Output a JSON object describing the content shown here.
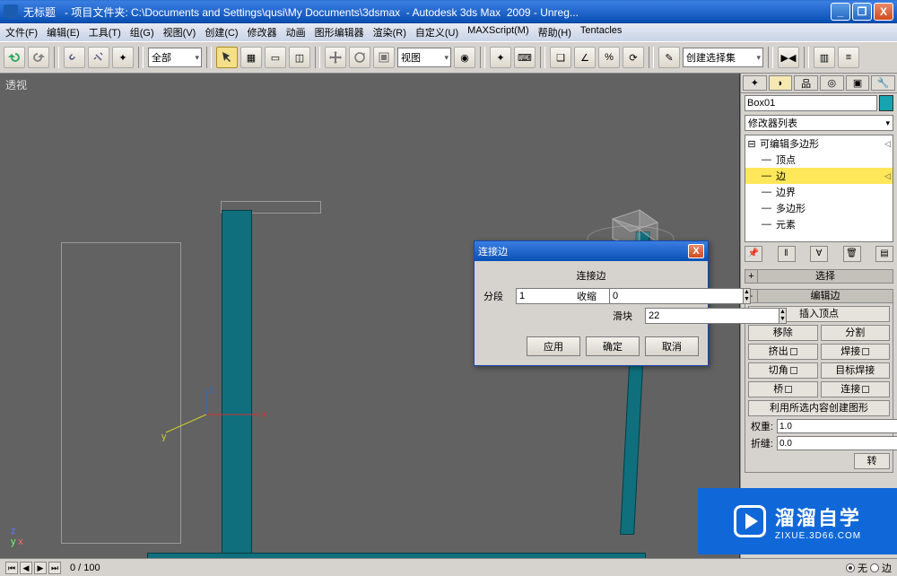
{
  "title": "无标题   - 项目文件夹: C:\\Documents and Settings\\qusi\\My Documents\\3dsmax  - Autodesk 3ds Max  2009 - Unreg...",
  "menu": [
    "文件(F)",
    "编辑(E)",
    "工具(T)",
    "组(G)",
    "视图(V)",
    "创建(C)",
    "修改器",
    "动画",
    "图形编辑器",
    "渲染(R)",
    "自定义(U)",
    "MAXScript(M)",
    "帮助(H)",
    "Tentacles"
  ],
  "toolbar": {
    "sel_filter": "全部",
    "view_dd": "视图",
    "named_sel": "创建选择集"
  },
  "viewport": {
    "label": "透视"
  },
  "panel": {
    "obj_name": "Box01",
    "mod_list": "修改器列表",
    "stack_root": "可编辑多边形",
    "sub": {
      "vertex": "顶点",
      "edge": "边",
      "border": "边界",
      "poly": "多边形",
      "element": "元素"
    },
    "rollout_sel": "选择",
    "rollout_edit": "编辑边",
    "btns": {
      "insert": "插入顶点",
      "remove": "移除",
      "split": "分割",
      "extrude": "挤出",
      "weld": "焊接",
      "chamfer": "切角",
      "target": "目标焊接",
      "bridge": "桥",
      "connect": "连接",
      "shape": "利用所选内容创建图形"
    },
    "weight": {
      "label": "权重:",
      "value": "1.0"
    },
    "crease": {
      "label": "折缝:",
      "value": "0.0"
    },
    "turn": "转"
  },
  "dialog": {
    "title": "连接边",
    "group": "连接边",
    "seg": {
      "label": "分段",
      "value": "1"
    },
    "pinch": {
      "label": "收缩",
      "value": "0"
    },
    "slide": {
      "label": "滑块",
      "value": "22"
    },
    "apply": "应用",
    "ok": "确定",
    "cancel": "取消"
  },
  "status": {
    "frame": "0 / 100",
    "radio_none": "无",
    "radio_edge": "边"
  },
  "watermark": {
    "big": "溜溜自学",
    "small": "ZIXUE.3D66.COM"
  }
}
